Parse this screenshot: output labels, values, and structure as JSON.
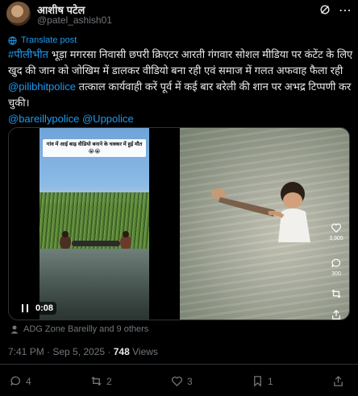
{
  "author": {
    "display_name": "आशीष पटेल",
    "handle": "@patel_ashish01"
  },
  "translate_label": "Translate post",
  "tweet": {
    "hashtag": "#पीलीभीत",
    "text_part1": " भूड़ा मगरसा निवासी छपरी क्रिएटर आरती गंगवार सोशल मीडिया पर कंटेंट के लिए खुद की जान को जोखिम में डालकर वीडियो बना रही एवं समाज में गलत अफवाह फैला रही ",
    "mention1": "@pilibhitpolice",
    "text_part2": " तत्काल कार्यवाही करें पूर्व में कई बार बरेली की शान पर अभद्र टिप्पणी कर चुकी।",
    "mention2": "@bareillypolice",
    "mention3": "@Uppolice"
  },
  "media": {
    "caption_overlay": "गांव में आई बाढ़ वीडियो बनाने के चक्कर में हुई मौत 😭😭",
    "timestamp": "0:08",
    "side_actions": {
      "likes": "3,905",
      "comments": "300"
    }
  },
  "reposted_by": "ADG Zone Bareilly and 9 others",
  "meta": {
    "time_date": "7:41 PM · Sep 5, 2025 · ",
    "views_count": "748",
    "views_label": " Views"
  },
  "actions": {
    "replies": "4",
    "reposts": "2",
    "likes": "3",
    "bookmarks": "1"
  },
  "colors": {
    "accent": "#1d9bf0",
    "muted": "#71767b",
    "text": "#e7e9ea",
    "background": "#000000"
  },
  "icons": [
    "grok-icon",
    "more-icon",
    "translate-icon",
    "pause-icon",
    "heart-icon",
    "comment-icon",
    "repost-icon",
    "share-icon",
    "reply-icon",
    "like-icon",
    "bookmark-icon"
  ]
}
